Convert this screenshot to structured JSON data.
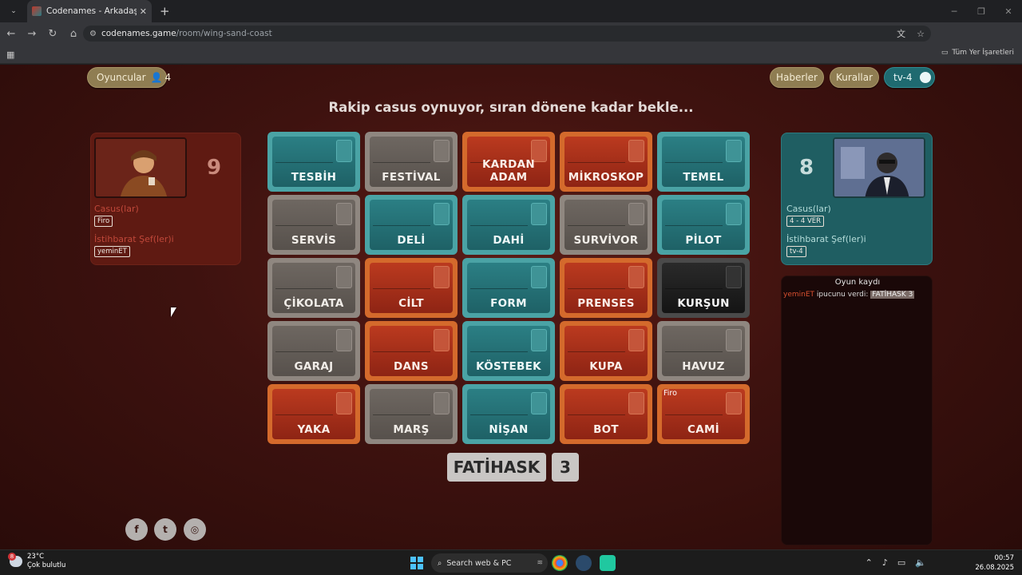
{
  "browser": {
    "tab_title": "Codenames - Arkadaşlarınızla ç",
    "url_host": "codenames.game",
    "url_path": "/room/wing-sand-coast",
    "bookmarks_label": "Tüm Yer İşaretleri"
  },
  "game": {
    "players_label": "Oyuncular",
    "players_count": "4",
    "news_label": "Haberler",
    "rules_label": "Kurallar",
    "user_label": "tv-4",
    "status_message": "Rakip casus oynuyor, sıran dönene kadar bekle...",
    "red_team": {
      "remaining": "9",
      "operatives_label": "Casus(lar)",
      "operatives": [
        "Firo"
      ],
      "spymasters_label": "İstihbarat Şef(ler)i",
      "spymasters": [
        "yeminET"
      ]
    },
    "blue_team": {
      "remaining": "8",
      "operatives_label": "Casus(lar)",
      "operatives": [
        "4 - 4 VER"
      ],
      "spymasters_label": "İstihbarat Şef(ler)i",
      "spymasters": [
        "tv-4"
      ]
    },
    "cards": [
      {
        "word": "TESBİH",
        "color": "blue"
      },
      {
        "word": "FESTİVAL",
        "color": "neutral"
      },
      {
        "word": "KARDAN ADAM",
        "color": "red"
      },
      {
        "word": "MİKROSKOP",
        "color": "red"
      },
      {
        "word": "TEMEL",
        "color": "blue"
      },
      {
        "word": "SERVİS",
        "color": "neutral"
      },
      {
        "word": "DELİ",
        "color": "blue"
      },
      {
        "word": "DAHİ",
        "color": "blue"
      },
      {
        "word": "SURVİVOR",
        "color": "neutral"
      },
      {
        "word": "PİLOT",
        "color": "blue"
      },
      {
        "word": "ÇİKOLATA",
        "color": "neutral"
      },
      {
        "word": "CİLT",
        "color": "red"
      },
      {
        "word": "FORM",
        "color": "blue"
      },
      {
        "word": "PRENSES",
        "color": "red"
      },
      {
        "word": "KURŞUN",
        "color": "assassin"
      },
      {
        "word": "GARAJ",
        "color": "neutral"
      },
      {
        "word": "DANS",
        "color": "red"
      },
      {
        "word": "KÖSTEBEK",
        "color": "blue"
      },
      {
        "word": "KUPA",
        "color": "red"
      },
      {
        "word": "HAVUZ",
        "color": "neutral"
      },
      {
        "word": "YAKA",
        "color": "red"
      },
      {
        "word": "MARŞ",
        "color": "neutral"
      },
      {
        "word": "NİŞAN",
        "color": "blue"
      },
      {
        "word": "BOT",
        "color": "red"
      },
      {
        "word": "CAMİ",
        "color": "red",
        "marker": "Firo"
      }
    ],
    "clue_word": "FATİHASK",
    "clue_number": "3",
    "log": {
      "title": "Oyun kaydı",
      "entry_user": "yeminET",
      "entry_text": "ipucunu verdi:",
      "entry_clue": "FATİHASK 3"
    },
    "social": [
      "facebook-icon",
      "twitter-icon",
      "instagram-icon"
    ]
  },
  "taskbar": {
    "weather_temp": "23°C",
    "weather_desc": "Çok bulutlu",
    "weather_badge": "8",
    "search_placeholder": "Search web & PC",
    "time": "00:57",
    "date": "26.08.2025"
  }
}
